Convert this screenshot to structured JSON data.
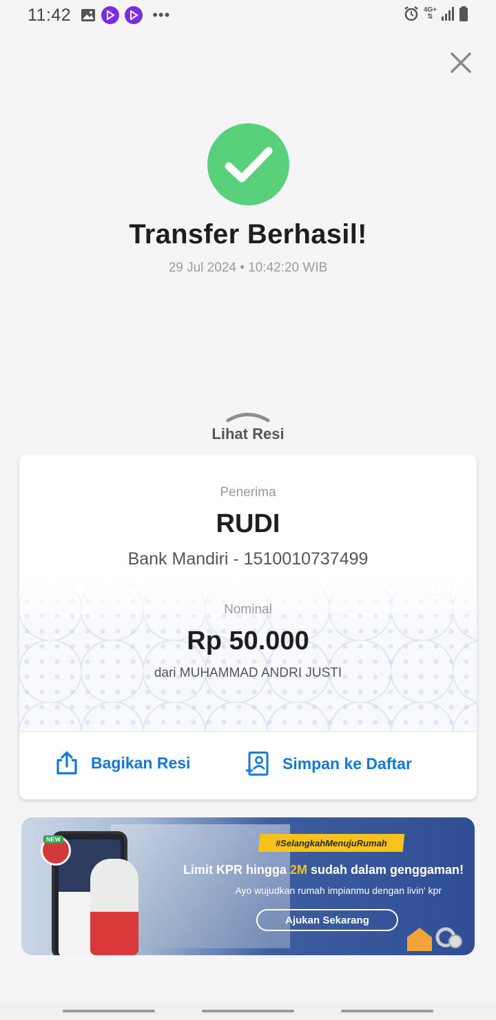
{
  "status_bar": {
    "time": "11:42",
    "network": "4G+",
    "icons": [
      "image-icon",
      "play-app-icon",
      "play-app-icon",
      "more-dots-icon",
      "alarm-icon",
      "signal-icon",
      "battery-icon"
    ]
  },
  "header": {
    "title": "Transfer Berhasil!",
    "datetime": "29 Jul 2024 • 10:42:20 WIB"
  },
  "lihat_resi": {
    "label": "Lihat Resi"
  },
  "receipt": {
    "recipient_label": "Penerima",
    "recipient_name": "RUDI",
    "recipient_bank": "Bank Mandiri - 1510010737499",
    "amount_label": "Nominal",
    "amount": "Rp 50.000",
    "from": "dari MUHAMMAD ANDRI JUSTI",
    "share_label": "Bagikan Resi",
    "save_label": "Simpan ke Daftar"
  },
  "banner": {
    "tag": "#SelangkahMenujuRumah",
    "headline_pre": "Limit KPR hingga ",
    "headline_highlight": "2M",
    "headline_post": " sudah dalam genggaman!",
    "subtitle": "Ayo wujudkan rumah impianmu dengan livin' kpr",
    "cta": "Ajukan Sekarang",
    "new_badge": "NEW"
  },
  "colors": {
    "success": "#59d17a",
    "action_blue": "#1078d8",
    "banner_yellow": "#f6c21c"
  }
}
